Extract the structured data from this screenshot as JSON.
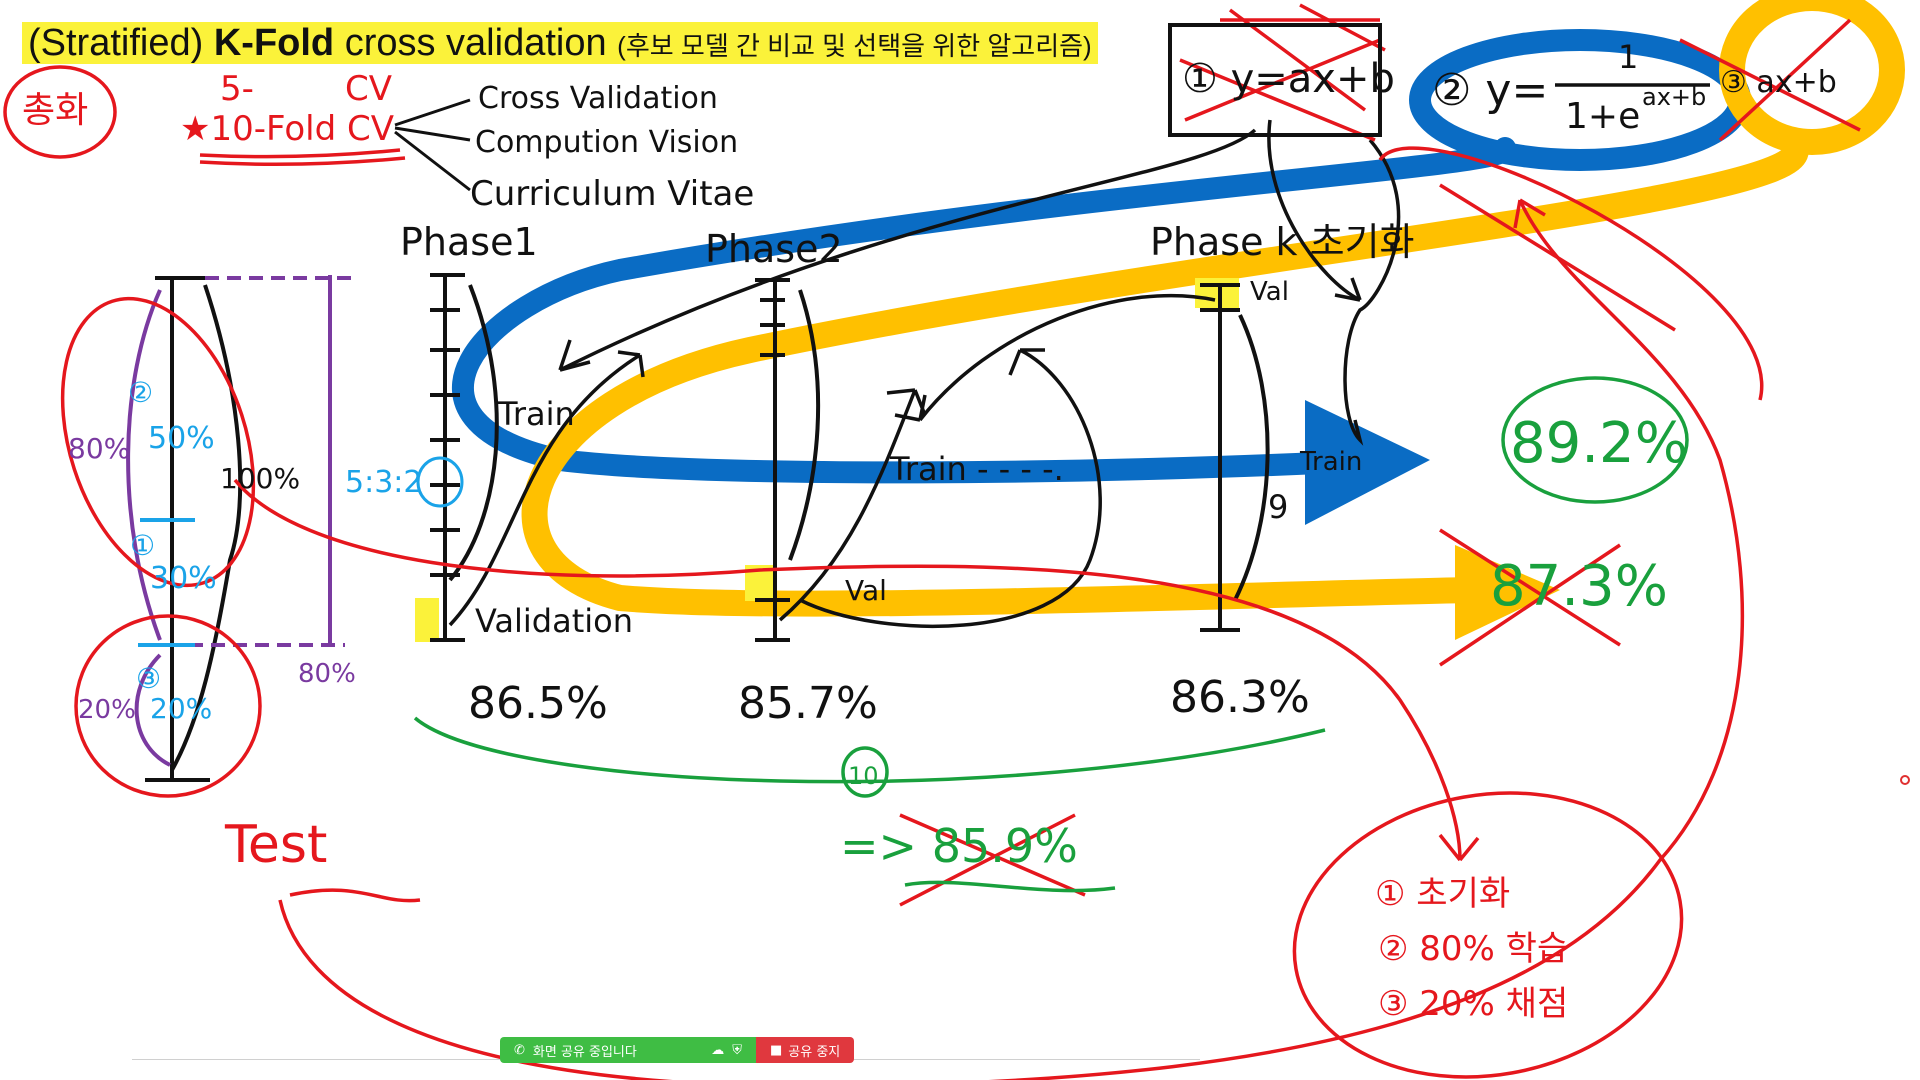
{
  "title": {
    "part1": "(Stratified)",
    "part2": "K-Fold",
    "part3": "cross validation",
    "subtitle": "(후보 모델 간 비교 및 선택을 위한 알고리즘)"
  },
  "annotations": {
    "summary_tag": "총화",
    "fold5": "5-",
    "fold10": "★10-Fold CV",
    "cv_top": "CV",
    "cv_meanings": [
      "Cross Validation",
      "Compution Vision",
      "Curriculum Vitae"
    ],
    "phase1": "Phase1",
    "phase2": "Phase2",
    "phase_k": "Phase k 초기화",
    "train": "Train",
    "train_dots": "Train - - - -.",
    "validation": "Validation",
    "val": "Val",
    "nine": "9",
    "ratio": "5:3:2",
    "pct_80": "80%",
    "pct_100": "100%",
    "pct_20": "20%",
    "pct_50": "50%",
    "pct_30": "30%",
    "pct_20b": "20%",
    "pct_80b": "80%",
    "circle_1": "①",
    "circle_2": "②",
    "circle_3": "③",
    "test": "Test",
    "phase1_score": "86.5%",
    "phase2_score": "85.7%",
    "phasek_score": "86.3%",
    "ten": "10",
    "avg_score": "=> 85.9%",
    "score_blue": "89.2%",
    "score_yellow": "87.3%",
    "models": {
      "m1": "① y=ax+b",
      "m2_prefix": "② y=",
      "m2_num": "1",
      "m2_den": "1+e",
      "m2_exp": "ax+b",
      "m3": "③ ax+b"
    },
    "steps": [
      "① 초기화",
      "② 80% 학습",
      "③ 20% 채점"
    ]
  },
  "share": {
    "status": "화면 공유 중입니다",
    "stop": "공유 중지"
  },
  "colors": {
    "red": "#e5171d",
    "blue": "#0a6cc4",
    "yellow": "#ffc000",
    "green": "#19a03d",
    "purple": "#7a3aa0",
    "cyan": "#1aa3e8",
    "highlight": "#fbf23a"
  }
}
